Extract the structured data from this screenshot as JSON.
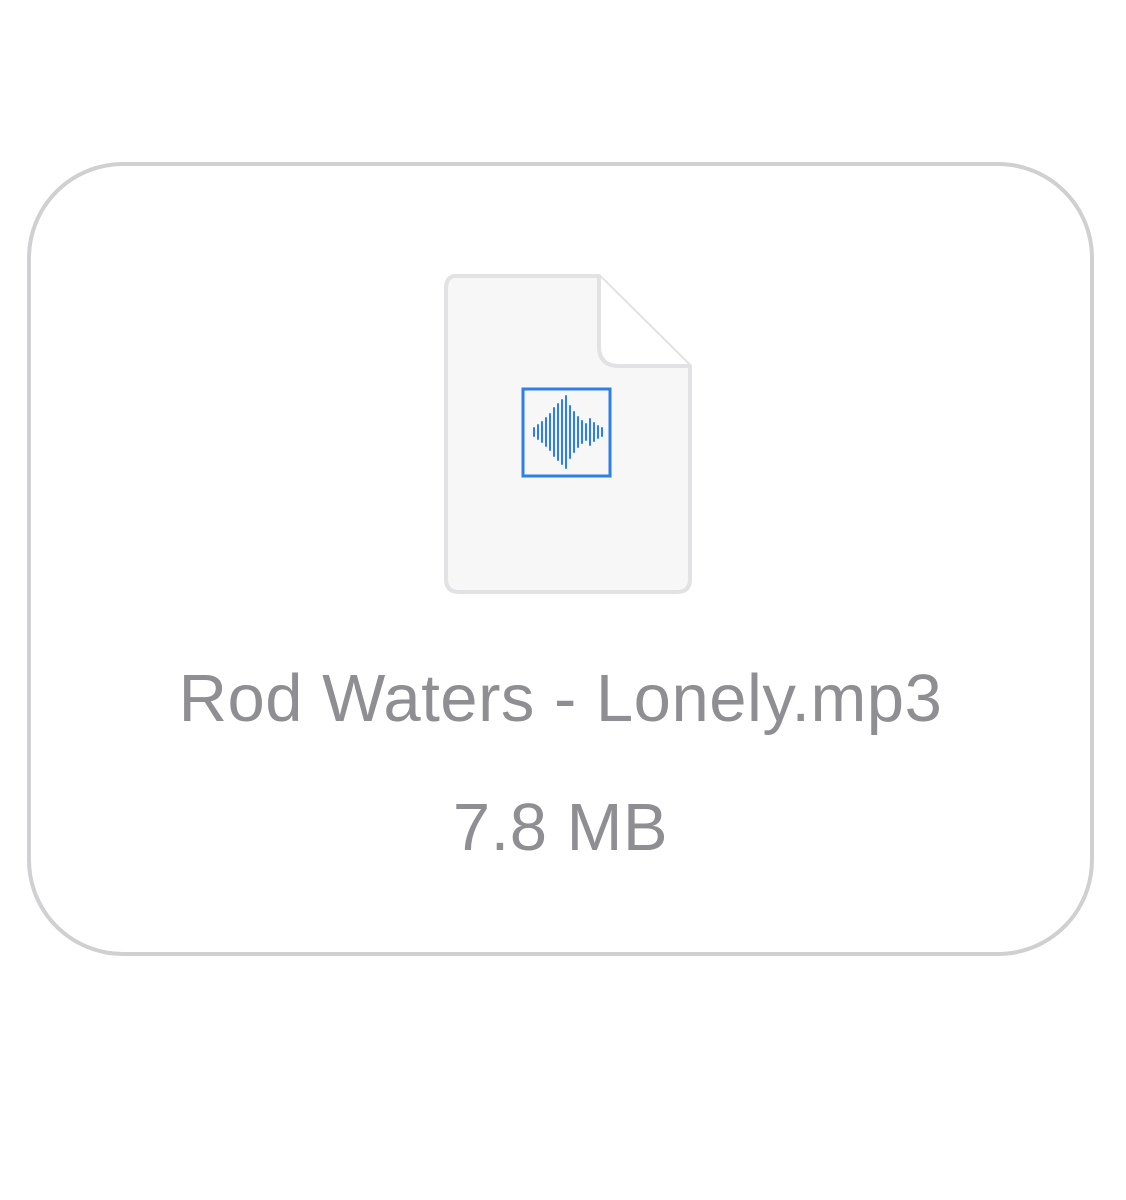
{
  "attachment": {
    "file_name": "Rod Waters - Lonely.mp3",
    "file_size": "7.8 MB",
    "icon": "audio-file-icon",
    "badge_icon": "waveform-icon",
    "colors": {
      "text": "#8e8e93",
      "card_border": "#d0d0d3",
      "document_fill": "#f7f7f8",
      "document_border": "#e2e2e4",
      "waveform": "#2f7fe8"
    }
  }
}
